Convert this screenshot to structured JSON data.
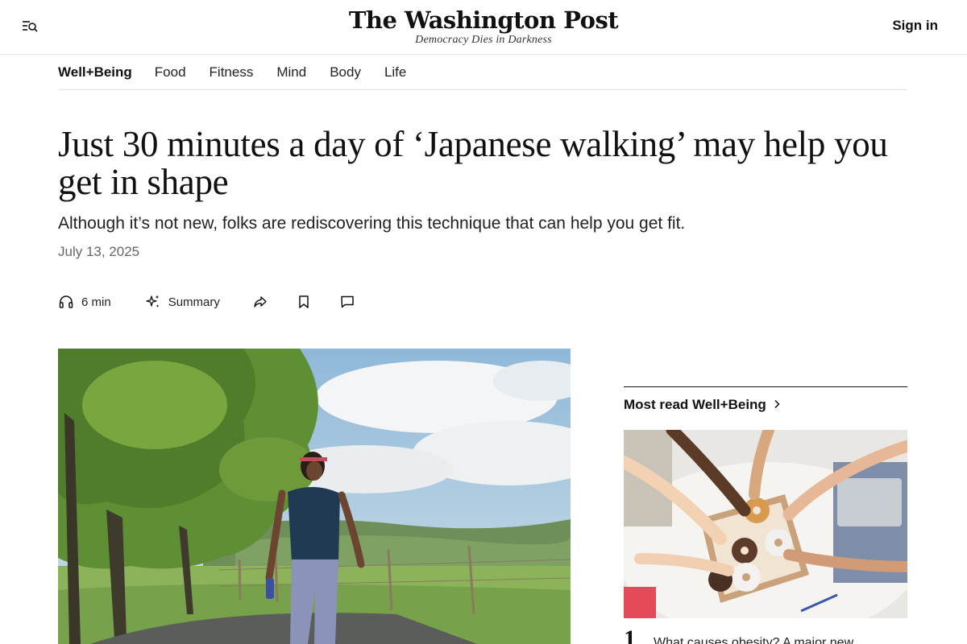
{
  "header": {
    "logo": "The Washington Post",
    "tagline": "Democracy Dies in Darkness",
    "sign_in": "Sign in",
    "menu_icon": "menu-search-icon"
  },
  "subnav": {
    "brand": "Well+Being",
    "links": [
      "Food",
      "Fitness",
      "Mind",
      "Body",
      "Life"
    ]
  },
  "article": {
    "headline": "Just 30 minutes a day of ‘Japanese walking’ may help you get in shape",
    "dek": "Although it’s not new, folks are rediscovering this technique that can help you get fit.",
    "date": "July 13, 2025",
    "actions": {
      "listen": "6 min",
      "summary": "Summary",
      "listen_icon": "headphones-icon",
      "summary_icon": "sparkle-icon",
      "share_icon": "share-icon",
      "save_icon": "bookmark-icon",
      "comment_icon": "comment-icon"
    }
  },
  "sidebar": {
    "title": "Most read Well+Being",
    "items": [
      {
        "rank": "1",
        "text": "What causes obesity? A major new"
      }
    ]
  },
  "colors": {
    "text": "#111111",
    "muted": "#666666",
    "divider": "#e3e3e3"
  }
}
